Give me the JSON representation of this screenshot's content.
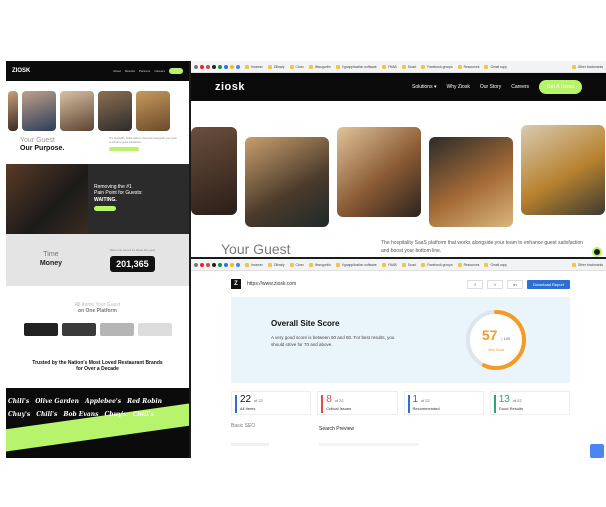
{
  "left_page": {
    "logo": "ZIOSK",
    "nav_links": [
      "About",
      "Results",
      "Partners",
      "Careers"
    ],
    "demo_label": "Demo",
    "purpose_title_light": "Your Guest",
    "purpose_title_bold": "Our Purpose.",
    "purpose_copy": "The hospitality SaaS platform that works alongside your team to enhance guest satisfaction.",
    "banner_line1": "Removing the #1",
    "banner_line2": "Pain Point for Guests:",
    "banner_line3": "WAITING.",
    "counter_label_top": "Time",
    "counter_label_bottom": "Money",
    "counter_caption": "Wait time saved by Ziosk this year",
    "counter_value": "201,365",
    "platform_line1": "All Items Your Guest",
    "platform_line2": "on One Platform",
    "trusted_line1": "Trusted by the Nation's Most Loved Restaurant Brands",
    "trusted_line2": "for Over a Decade",
    "brands": [
      "Chili's",
      "Olive Garden",
      "Applebee's",
      "Red Robin",
      "Chuy's",
      "Chili's",
      "Bob Evans",
      "Chuy's",
      "Chili's"
    ]
  },
  "browser": {
    "bookmarks": [
      "Imomax",
      "Zillowly",
      "Cloxx",
      "Ithsogonlin",
      "Vgoapplication software",
      "YNAB",
      "Scout",
      "Facebook groups",
      "Resources",
      "Gmail copy"
    ],
    "other_bookmarks": "Other bookmarks"
  },
  "ziosk_site": {
    "logo": "ziosk",
    "nav": [
      "Solutions",
      "Why Ziosk",
      "Our Story",
      "Careers"
    ],
    "cta": "Get A Demo",
    "hero": "Your Guest",
    "subtitle": "The hospitality SaaS platform that works alongside your team to enhance guest satisfaction and boost your bottom line."
  },
  "seo_report": {
    "logo": "Z",
    "url": "https://www.ziosk.com",
    "share_icons": [
      "f",
      "t",
      "in"
    ],
    "download_label": "Download Report",
    "title": "Overall Site Score",
    "description": "A very good score is between 60 and 80. For best results, you should strive for 70 and above.",
    "score": "57",
    "score_max": "/ 100",
    "score_label": "Very Good",
    "score_fraction": 0.57,
    "stats": [
      {
        "value": "22",
        "of": "of 22",
        "label": "All Items",
        "color": "#2f6fd1"
      },
      {
        "value": "8",
        "of": "of 22",
        "label": "Critical Issues",
        "color": "#e24c4c"
      },
      {
        "value": "1",
        "of": "of 22",
        "label": "Recommended",
        "color": "#2f6fd1"
      },
      {
        "value": "13",
        "of": "of 22",
        "label": "Good Results",
        "color": "#2ca66b"
      }
    ],
    "basic_seo": "Basic SEO",
    "search_preview": "Search Preview"
  },
  "colors": {
    "accent": "#b7f36b",
    "score_orange": "#f59a23",
    "download_blue": "#2f6fd1"
  }
}
